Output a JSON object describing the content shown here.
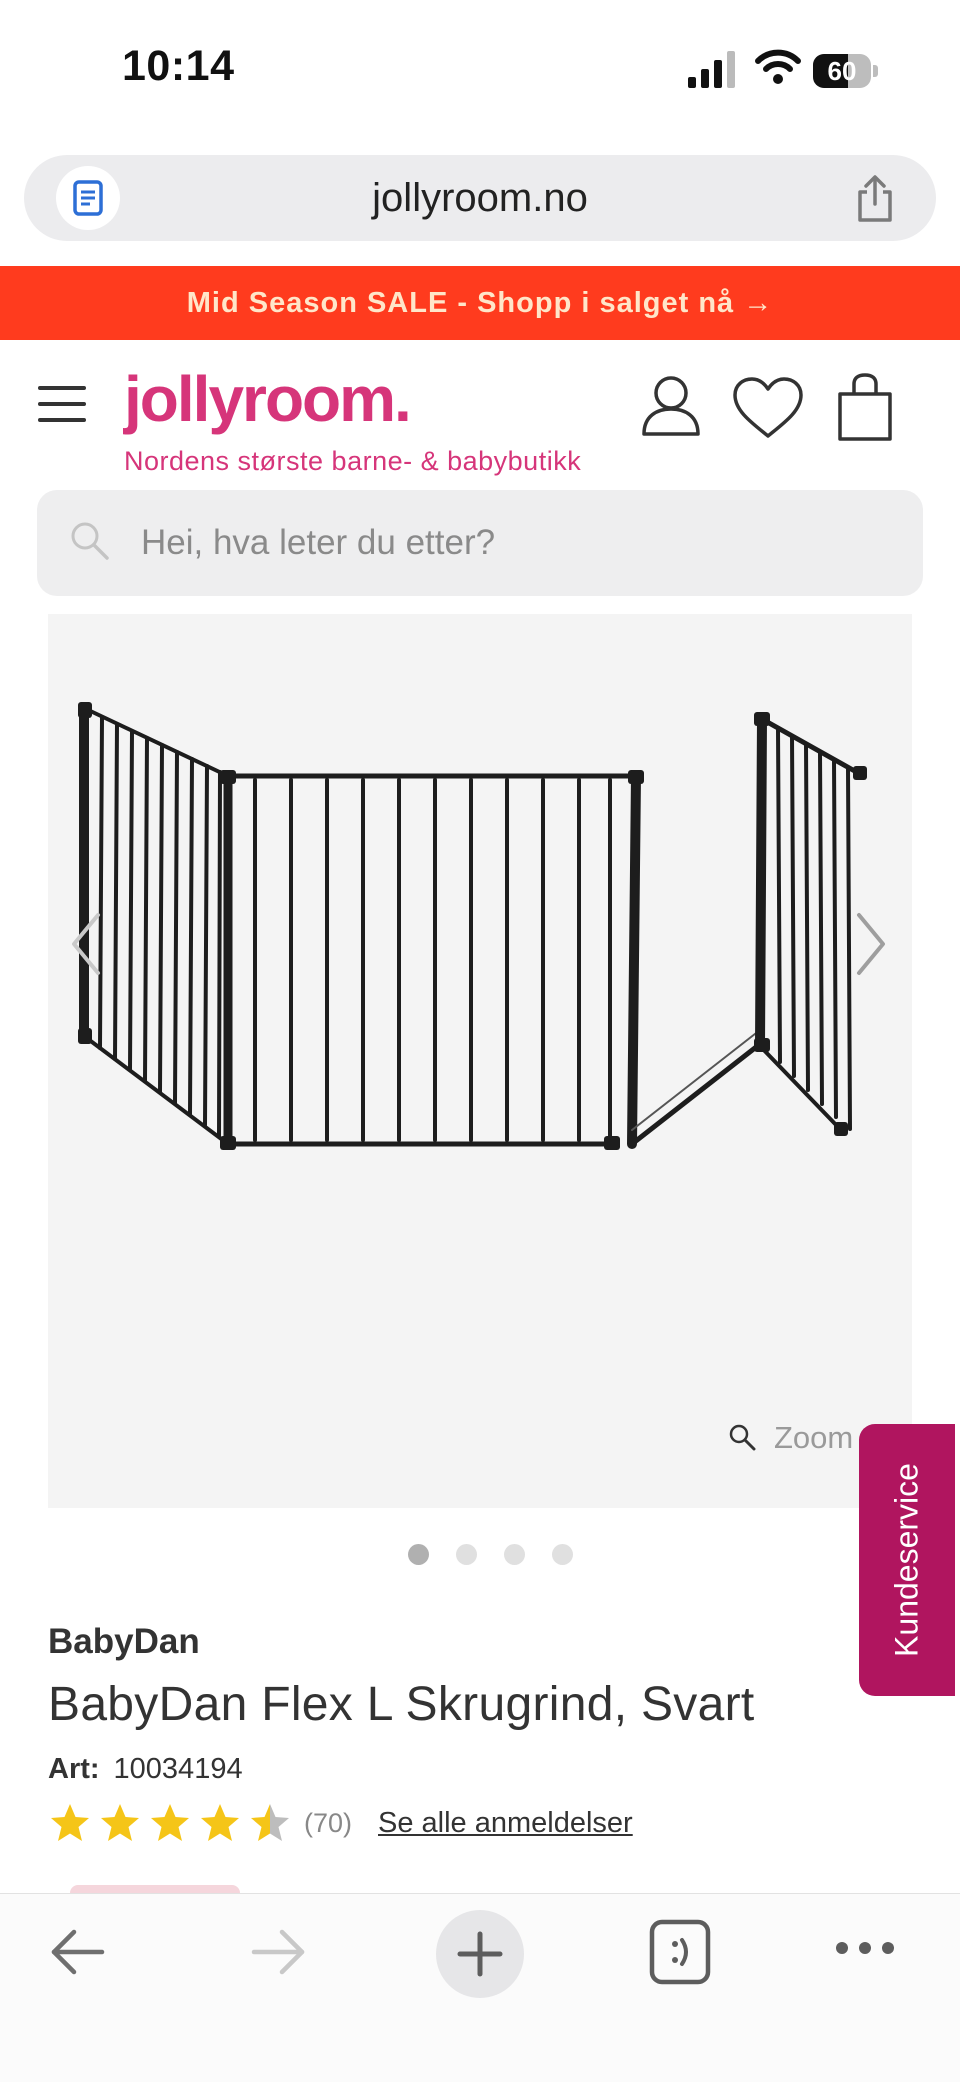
{
  "status_bar": {
    "time": "10:14",
    "battery": "60",
    "battery_level": 0.6
  },
  "browser": {
    "url": "jollyroom.no"
  },
  "promo": {
    "text": "Mid Season SALE - Shopp i salget nå →"
  },
  "header": {
    "logo": "jollyroom.",
    "tagline": "Nordens største barne- & babybutikk"
  },
  "search": {
    "placeholder": "Hei, hva leter du etter?"
  },
  "gallery": {
    "zoom_label": "Zoom",
    "image_count": 4,
    "active_index": 0
  },
  "support": {
    "label": "Kundeservice"
  },
  "product": {
    "brand": "BabyDan",
    "title": "BabyDan Flex L Skrugrind, Svart",
    "art_label": "Art:",
    "art_number": "10034194",
    "rating": 4.5,
    "review_count": "(70)",
    "reviews_link": "Se alle anmeldelser"
  },
  "colors": {
    "brand_pink": "#d6357a",
    "promo_bg": "#ff3b1e",
    "promo_text": "#ffe6c9",
    "support_bg": "#b0155f",
    "star": "#f5c518"
  },
  "icons": {
    "reader": "reader-icon",
    "share": "share-icon",
    "menu": "menu-icon",
    "account": "account-icon",
    "wishlist": "heart-icon",
    "cart": "bag-icon",
    "search": "search-icon",
    "zoom": "zoom-icon",
    "back": "back-arrow-icon",
    "forward": "forward-arrow-icon",
    "new_tab": "plus-icon",
    "tabs": "tabs-icon",
    "more": "more-icon"
  }
}
